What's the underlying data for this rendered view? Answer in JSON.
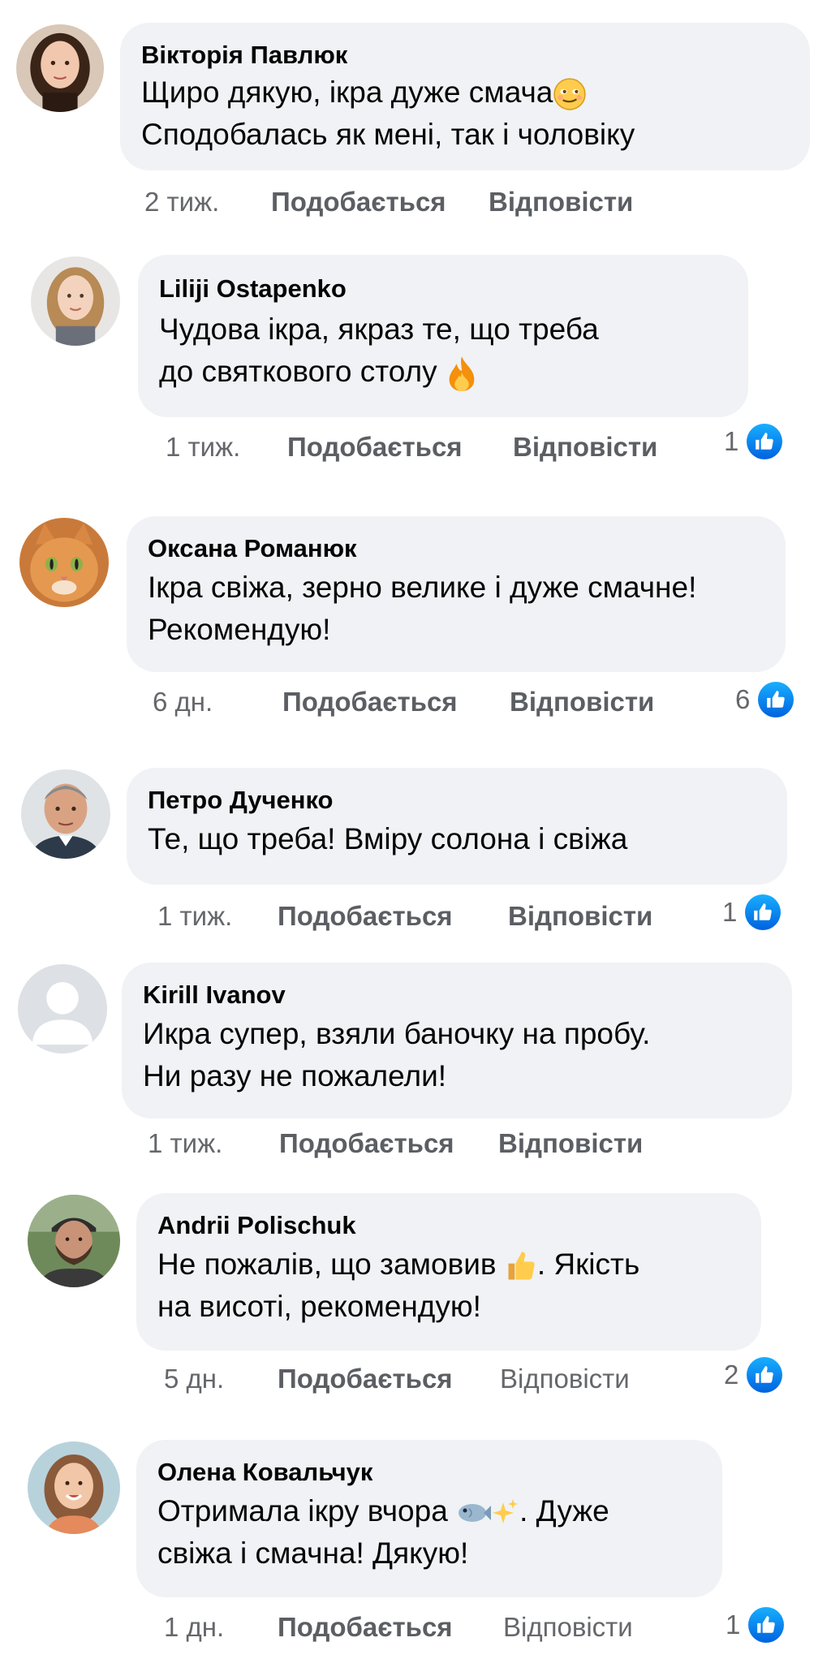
{
  "comments": [
    {
      "author": "Вікторія Павлюк",
      "lines": [
        "Щиро дякую, ікра дуже смача",
        "Сподобалась як мені, так і чоловіку"
      ],
      "time": "2 тиж.",
      "like_label": "Подобається",
      "reply_label": "Відповісти",
      "reactions": null,
      "emoji": "smiling-face-emoji",
      "avatar": "woman-dark-hair-avatar"
    },
    {
      "author": "Liliji Ostapenko",
      "lines": [
        "Чудова ікра, якраз те, що треба",
        "до святкового столу"
      ],
      "time": "1 тиж.",
      "like_label": "Подобається",
      "reply_label": "Відповісти",
      "reactions": "1",
      "emoji": "fire-emoji",
      "avatar": "woman-blonde-avatar"
    },
    {
      "author": "Оксана Романюк",
      "lines": [
        "Ікра свіжа, зерно велике і дуже смачне!",
        "Рекомендую!"
      ],
      "time": "6 дн.",
      "like_label": "Подобається",
      "reply_label": "Відповісти",
      "reactions": "6",
      "avatar": "orange-cat-avatar"
    },
    {
      "author": "Петро Дученко",
      "lines": [
        "Те, що треба! Вміру солона і свіжа"
      ],
      "time": "1 тиж.",
      "like_label": "Подобається",
      "reply_label": "Відповісти",
      "reactions": "1",
      "avatar": "older-man-avatar"
    },
    {
      "author": "Kirill Ivanov",
      "lines": [
        "Икра супер, взяли баночку на пробу.",
        "Ни разу не пожалели!"
      ],
      "time": "1 тиж.",
      "like_label": "Подобається",
      "reply_label": "Відповісти",
      "reactions": null,
      "avatar": "default-user-avatar"
    },
    {
      "author": "Andrii Polischuk",
      "lines": [
        "Не пожалів, що замовив . Якість",
        "на висоті, рекомендую!"
      ],
      "time": "5 дн.",
      "like_label": "Подобається",
      "reply_label": "Відповісти",
      "reactions": "2",
      "emoji": "thumbs-up-emoji",
      "avatar": "bearded-man-cap-avatar"
    },
    {
      "author": "Олена Ковальчук",
      "lines": [
        "Отримала ікру вчора . Дуже",
        "свіжа і смачна! Дякую!"
      ],
      "time": "1 дн.",
      "like_label": "Подобається",
      "reply_label": "Відповісти",
      "reactions": "1",
      "emoji": "fish-sparkles-emoji",
      "avatar": "smiling-woman-avatar"
    }
  ],
  "colors": {
    "bubble": "#f0f2f5",
    "meta_text": "#65676b",
    "like_badge": "#0866ff"
  }
}
